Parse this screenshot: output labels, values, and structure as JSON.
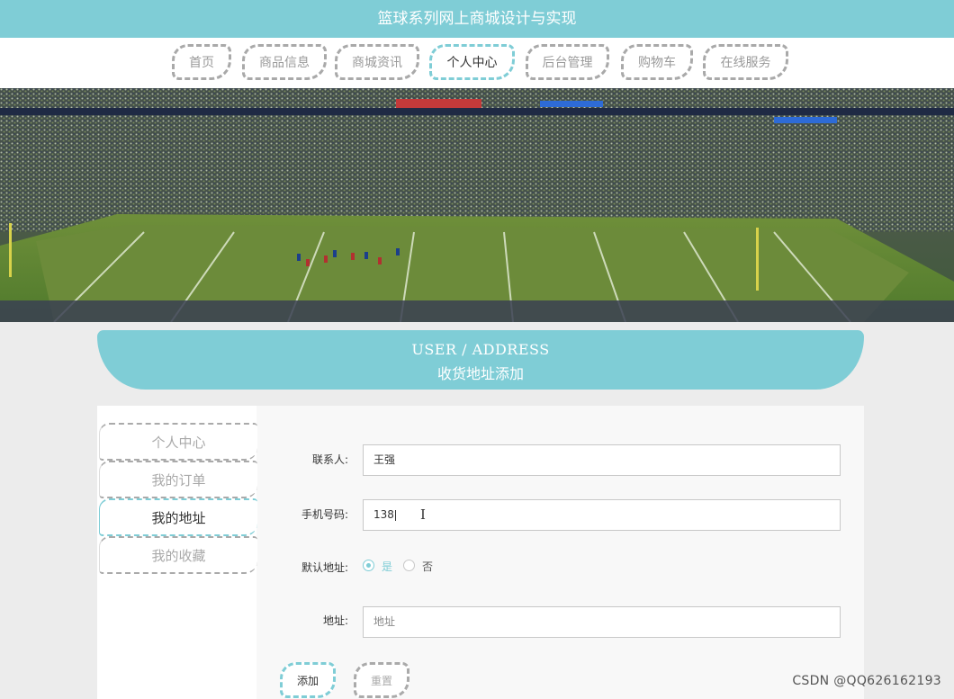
{
  "app": {
    "title": "篮球系列网上商城设计与实现"
  },
  "nav": {
    "items": [
      {
        "label": "首页"
      },
      {
        "label": "商品信息"
      },
      {
        "label": "商城资讯"
      },
      {
        "label": "个人中心",
        "active": true
      },
      {
        "label": "后台管理"
      },
      {
        "label": "购物车"
      },
      {
        "label": "在线服务"
      }
    ]
  },
  "section": {
    "title_en": "USER / ADDRESS",
    "title_cn": "收货地址添加"
  },
  "sidebar": {
    "items": [
      {
        "label": "个人中心"
      },
      {
        "label": "我的订单"
      },
      {
        "label": "我的地址",
        "active": true
      },
      {
        "label": "我的收藏"
      }
    ]
  },
  "form": {
    "contact_label": "联系人:",
    "contact_value": "王强",
    "phone_label": "手机号码:",
    "phone_value": "138",
    "default_label": "默认地址:",
    "default_yes": "是",
    "default_no": "否",
    "default_selected": "是",
    "address_label": "地址:",
    "address_placeholder": "地址",
    "add_button": "添加",
    "reset_button": "重置"
  },
  "watermark": "CSDN @QQ626162193",
  "colors": {
    "accent": "#7fcdd6",
    "border_inactive": "#a9a9a9"
  }
}
